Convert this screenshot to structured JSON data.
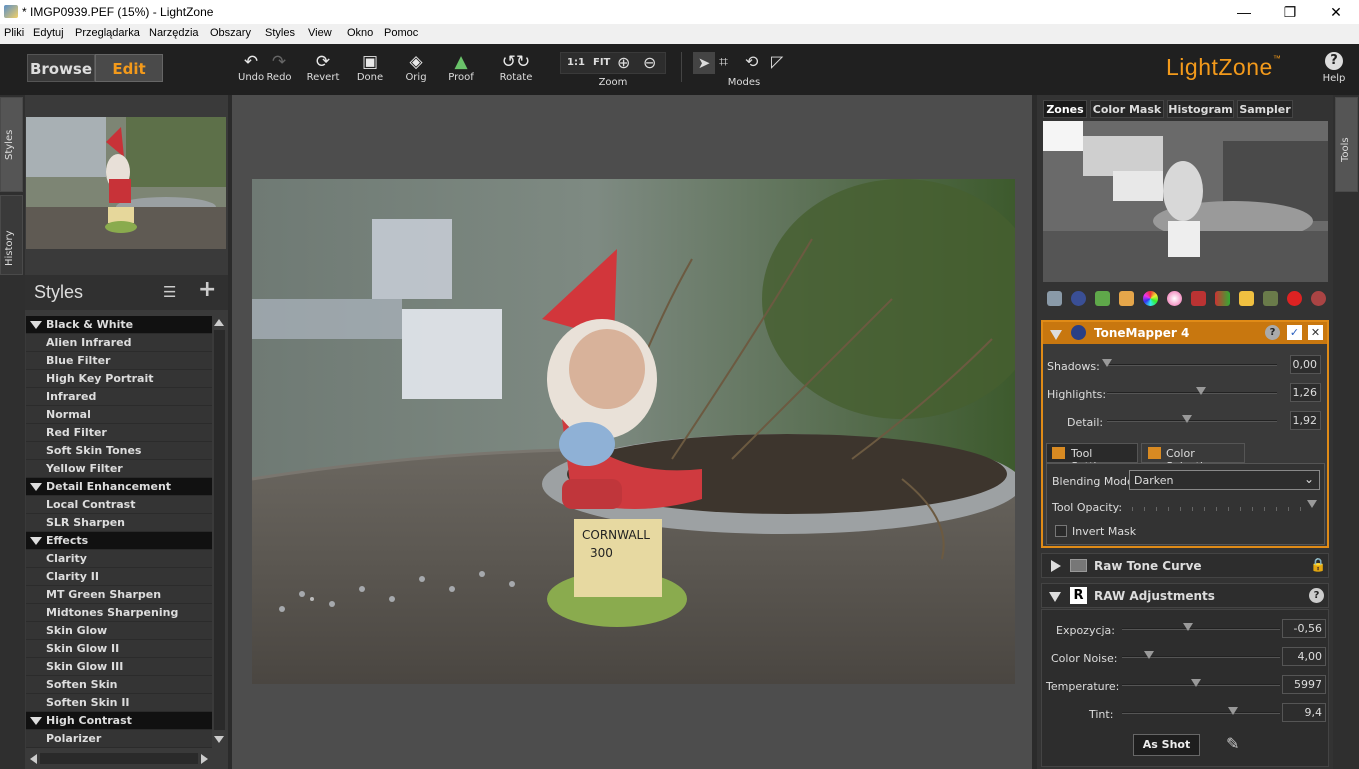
{
  "window": {
    "title": "* IMGP0939.PEF (15%) - LightZone",
    "minimize": "—",
    "maximize": "❐",
    "close": "✕"
  },
  "menu": [
    "Pliki",
    "Edytuj",
    "Przeglądarka",
    "Narzędzia",
    "Obszary",
    "Styles",
    "View",
    "Okno",
    "Pomoc"
  ],
  "toolbar": {
    "browse": "Browse",
    "edit": "Edit",
    "undo": "Undo",
    "redo": "Redo",
    "revert": "Revert",
    "done": "Done",
    "orig": "Orig",
    "proof": "Proof",
    "rotate": "Rotate",
    "zoom_1to1": "1:1",
    "zoom_fit": "FIT",
    "zoom": "Zoom",
    "modes": "Modes",
    "logo": "LightZone",
    "logo_tm": "™",
    "help": "Help"
  },
  "left_tabs": {
    "styles": "Styles",
    "history": "History"
  },
  "styles_panel": {
    "title": "Styles",
    "items": [
      {
        "label": "Black & White",
        "category": true
      },
      {
        "label": "Alien Infrared",
        "category": false
      },
      {
        "label": "Blue Filter",
        "category": false
      },
      {
        "label": "High Key Portrait",
        "category": false
      },
      {
        "label": "Infrared",
        "category": false
      },
      {
        "label": "Normal",
        "category": false
      },
      {
        "label": "Red Filter",
        "category": false
      },
      {
        "label": "Soft Skin Tones",
        "category": false
      },
      {
        "label": "Yellow Filter",
        "category": false
      },
      {
        "label": "Detail Enhancement",
        "category": true
      },
      {
        "label": "Local Contrast",
        "category": false
      },
      {
        "label": "SLR Sharpen",
        "category": false
      },
      {
        "label": "Effects",
        "category": true
      },
      {
        "label": "Clarity",
        "category": false
      },
      {
        "label": "Clarity II",
        "category": false
      },
      {
        "label": "MT Green Sharpen",
        "category": false
      },
      {
        "label": "Midtones Sharpening",
        "category": false
      },
      {
        "label": "Skin Glow",
        "category": false
      },
      {
        "label": "Skin Glow II",
        "category": false
      },
      {
        "label": "Skin Glow III",
        "category": false
      },
      {
        "label": "Soften Skin",
        "category": false
      },
      {
        "label": "Soften Skin II",
        "category": false
      },
      {
        "label": "High Contrast",
        "category": true
      },
      {
        "label": "Polarizer",
        "category": false
      }
    ]
  },
  "right_tabs": {
    "tools": "Tools"
  },
  "inspector_tabs": [
    "Zones",
    "Color Mask",
    "Histogram",
    "Sampler"
  ],
  "tonemapper": {
    "title": "ToneMapper 4",
    "shadows_label": "Shadows:",
    "shadows_value": "0,00",
    "shadows": 0.0,
    "highlights_label": "Highlights:",
    "highlights_value": "1,26",
    "highlights": 0.55,
    "detail_label": "Detail:",
    "detail_value": "1,92",
    "detail": 0.47,
    "tab_tool_settings": "Tool Settings",
    "tab_color_selection": "Color Selection",
    "blending_label": "Blending Mode:",
    "blending_value": "Darken",
    "opacity_label": "Tool Opacity:",
    "opacity": 1.0,
    "invert_mask": "Invert Mask"
  },
  "raw_tone_curve": {
    "title": "Raw Tone Curve"
  },
  "raw_adjustments": {
    "title": "RAW Adjustments",
    "exposure_label": "Expozycja:",
    "exposure_value": "-0,56",
    "exposure": 0.42,
    "noise_label": "Color Noise:",
    "noise_value": "4,00",
    "noise": 0.17,
    "temp_label": "Temperature:",
    "temp_value": "5997",
    "temp": 0.47,
    "tint_label": "Tint:",
    "tint_value": "9,4",
    "tint": 0.7,
    "as_shot": "As Shot"
  }
}
